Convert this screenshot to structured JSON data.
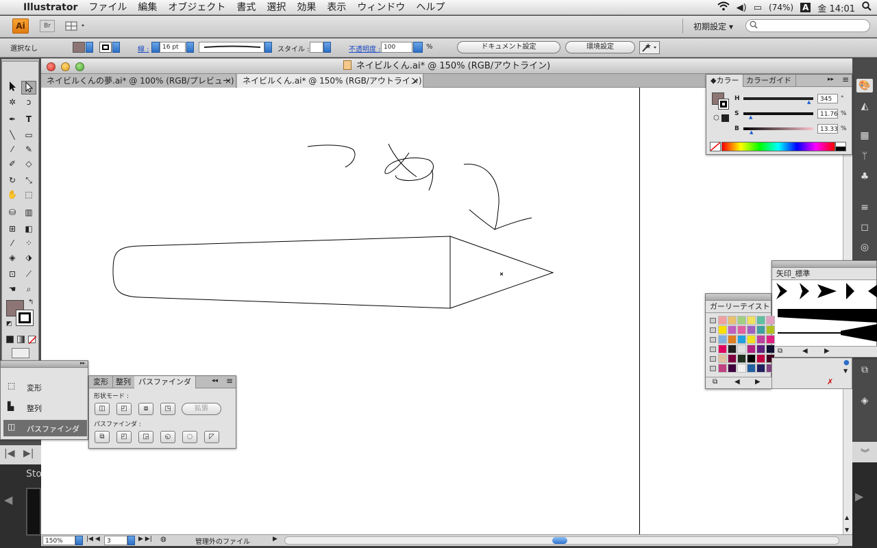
{
  "menubar": {
    "app_name": "Illustrator",
    "items": [
      "ファイル",
      "編集",
      "オブジェクト",
      "書式",
      "選択",
      "効果",
      "表示",
      "ウィンドウ",
      "ヘルプ"
    ],
    "battery": "(74%)",
    "input_method": "A",
    "clock": "金 14:01"
  },
  "appbar": {
    "logo": "Ai",
    "bridge": "Br",
    "workspace": "初期設定 ▾"
  },
  "control_bar": {
    "selection": "選択なし",
    "stroke_label": "線 :",
    "stroke_width": "16 pt",
    "style_label": "スタイル :",
    "opacity_label": "不透明度 :",
    "opacity_value": "100",
    "percent": "%",
    "doc_settings": "ドキュメント設定",
    "prefs": "環境設定",
    "fill_color": "#8c7574"
  },
  "document": {
    "window_title": "ネイビルくん.ai* @ 150% (RGB/アウトライン)",
    "tabs": [
      {
        "label": "ネイビルくんの夢.ai* @ 100% (RGB/プレビュー)"
      },
      {
        "label": "ネイビルくん.ai* @ 150% (RGB/アウトライン)"
      }
    ],
    "zoom": "150%",
    "page": "3",
    "status": "管理外のファイル"
  },
  "color_panel": {
    "tabs": [
      "カラー",
      "カラーガイド"
    ],
    "h_label": "H",
    "h_value": "345",
    "h_unit": "°",
    "s_label": "S",
    "s_value": "11.76",
    "s_unit": "%",
    "b_label": "B",
    "b_value": "13.33",
    "b_unit": "%"
  },
  "arrow_panel": {
    "title": "矢印_標準"
  },
  "swatch_panel": {
    "title": "ガーリーテイスト",
    "colors": [
      [
        "#f0a0a0",
        "#e8c070",
        "#a0d080",
        "#f0e060",
        "#60c0a0",
        "#e0a0c0"
      ],
      [
        "#f8e000",
        "#c060c0",
        "#e060a0",
        "#a060c0",
        "#40a0a0",
        "#b0c020"
      ],
      [
        "#80b0e0",
        "#e08020",
        "#20a0e0",
        "#f0e020",
        "#c040a0",
        "#e02080"
      ],
      [
        "#e00060",
        "#202020",
        "#e0e0e0",
        "#b02080",
        "#602080",
        "#101030"
      ],
      [
        "#e0c0a0",
        "#800040",
        "#203020",
        "#000000",
        "#c00040",
        "#400020"
      ],
      [
        "#c04080",
        "#400040",
        "#f0f0f0",
        "#2060a0",
        "#202060",
        "#804080"
      ]
    ]
  },
  "transform_panel": {
    "items": [
      {
        "label": "変形",
        "icon": "transform-icon"
      },
      {
        "label": "整列",
        "icon": "align-icon"
      },
      {
        "label": "パスファインダ",
        "icon": "pathfinder-icon"
      }
    ]
  },
  "pathfinder_panel": {
    "tabs": [
      "変形",
      "整列",
      "パスファインダ"
    ],
    "shape_mode_label": "形状モード :",
    "expand": "拡張",
    "pathfinder_label": "パスファインダ :"
  },
  "filmstrip": {
    "label": "Sto"
  }
}
